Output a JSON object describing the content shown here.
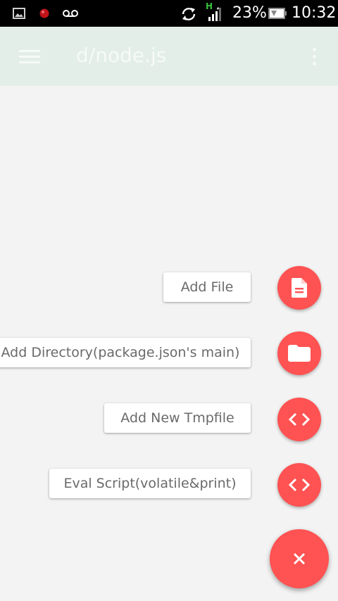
{
  "status_bar": {
    "battery": "23%",
    "time": "10:32",
    "network_type": "H",
    "icons": [
      "gallery-icon",
      "record-icon",
      "voicemail-icon",
      "sync-icon",
      "signal-icon",
      "battery-icon"
    ]
  },
  "app_bar": {
    "title": "d/node.js",
    "menu_icon": "hamburger-menu-icon",
    "overflow_icon": "more-vert-icon"
  },
  "fab_menu": {
    "accent_color": "#ff5252",
    "items": [
      {
        "label": "Add File",
        "icon": "file-icon"
      },
      {
        "label": "Add Directory(package.json's main)",
        "icon": "folder-icon"
      },
      {
        "label": "Add New Tmpfile",
        "icon": "code-icon"
      },
      {
        "label": "Eval Script(volatile&print)",
        "icon": "code-icon"
      }
    ],
    "close_icon": "close-icon"
  }
}
